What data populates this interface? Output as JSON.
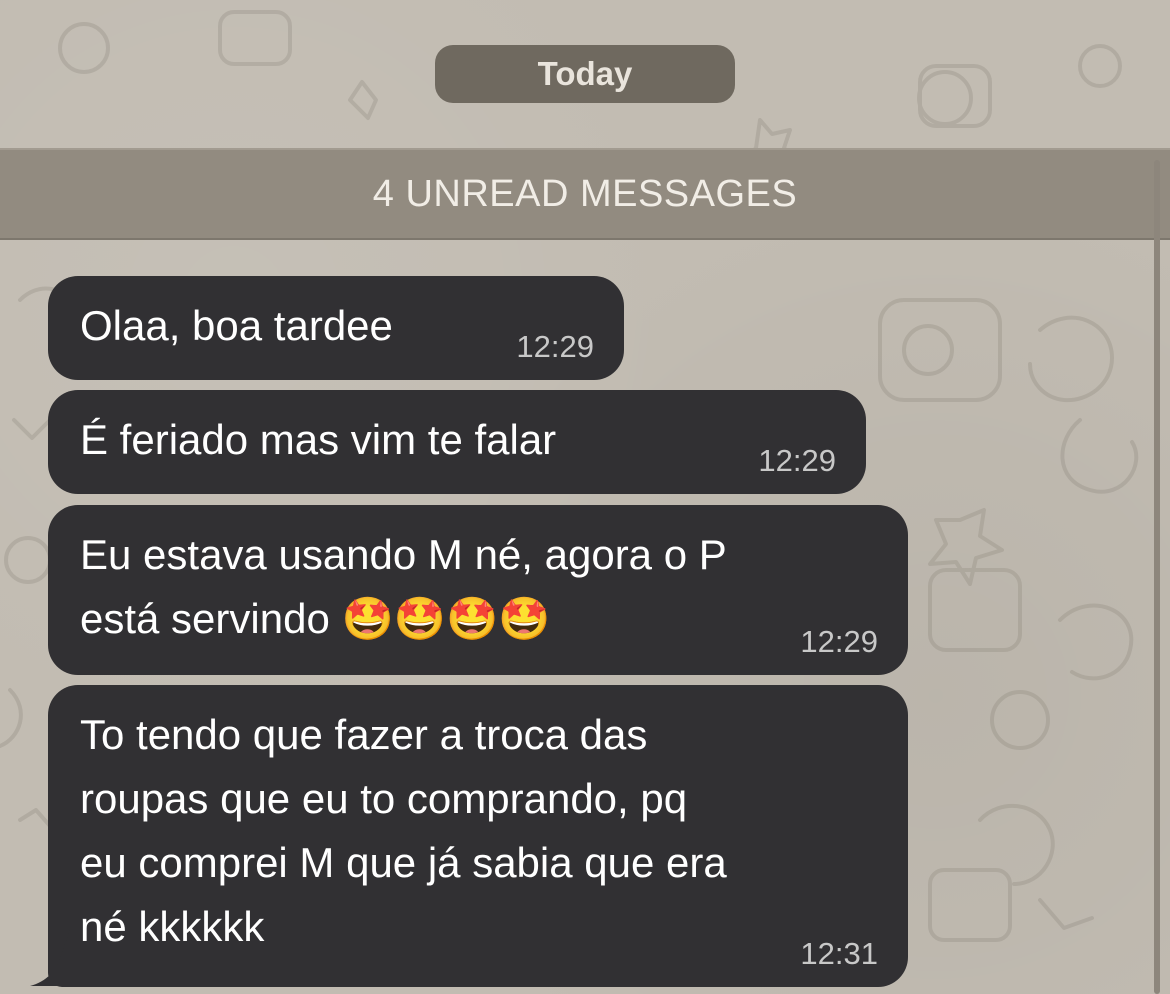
{
  "chat": {
    "date_label": "Today",
    "unread_label": "4 UNREAD MESSAGES"
  },
  "messages": [
    {
      "text": "Olaa, boa tardee",
      "time": "12:29"
    },
    {
      "text": "É feriado mas vim te falar",
      "time": "12:29"
    },
    {
      "text": "Eu estava usando M né, agora o P\nestá servindo 🤩🤩🤩🤩",
      "time": "12:29"
    },
    {
      "text": "To tendo que fazer a troca das\nroupas que eu to comprando, pq\neu comprei M que já sabia que era\nné kkkkkk",
      "time": "12:31"
    }
  ],
  "colors": {
    "background": "#c2bcb2",
    "bubble": "#313033",
    "time_text": "#c8c8c8",
    "unread_bar": "#928b80"
  }
}
